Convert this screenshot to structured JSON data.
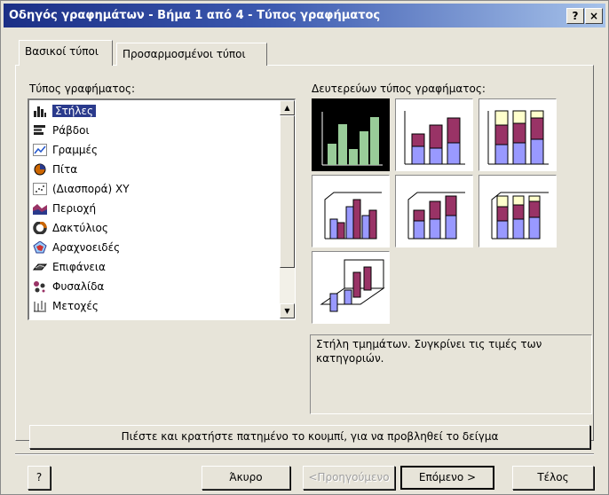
{
  "window": {
    "title": "Οδηγός γραφημάτων - Βήμα 1 από 4 - Τύπος γραφήματος",
    "help_btn": "?",
    "close_btn": "×"
  },
  "tabs": [
    {
      "label": "Βασικοί τύποι",
      "active": true
    },
    {
      "label": "Προσαρμοσμένοι τύποι",
      "active": false
    }
  ],
  "chart_type": {
    "label": "Τύπος γραφήματος:",
    "items": [
      {
        "label": "Στήλες",
        "icon": "column-chart-icon",
        "selected": true
      },
      {
        "label": "Ράβδοι",
        "icon": "bar-chart-icon",
        "selected": false
      },
      {
        "label": "Γραμμές",
        "icon": "line-chart-icon",
        "selected": false
      },
      {
        "label": "Πίτα",
        "icon": "pie-chart-icon",
        "selected": false
      },
      {
        "label": "(Διασπορά) XY",
        "icon": "scatter-chart-icon",
        "selected": false
      },
      {
        "label": "Περιοχή",
        "icon": "area-chart-icon",
        "selected": false
      },
      {
        "label": "Δακτύλιος",
        "icon": "doughnut-chart-icon",
        "selected": false
      },
      {
        "label": "Αραχνοειδές",
        "icon": "radar-chart-icon",
        "selected": false
      },
      {
        "label": "Επιφάνεια",
        "icon": "surface-chart-icon",
        "selected": false
      },
      {
        "label": "Φυσαλίδα",
        "icon": "bubble-chart-icon",
        "selected": false
      },
      {
        "label": "Μετοχές",
        "icon": "stock-chart-icon",
        "selected": false
      }
    ]
  },
  "subtype": {
    "label": "Δευτερεύων τύπος γραφήματος:",
    "selected_index": 0,
    "description": "Στήλη τμημάτων. Συγκρίνει τις τιμές των κατηγοριών."
  },
  "colors": {
    "blue_series": "#9999ff",
    "magenta_series": "#993366",
    "yellow_series": "#ffffcc",
    "selected_green": "#99cc99"
  },
  "preview_button": "Πιέστε και κρατήστε πατημένο το κουμπί, για να προβληθεί το δείγμα",
  "buttons": {
    "help": "?",
    "cancel": "Άκυρο",
    "back": "<Προηγούμενο",
    "next": "Επόμενο >",
    "finish": "Τέλος"
  }
}
